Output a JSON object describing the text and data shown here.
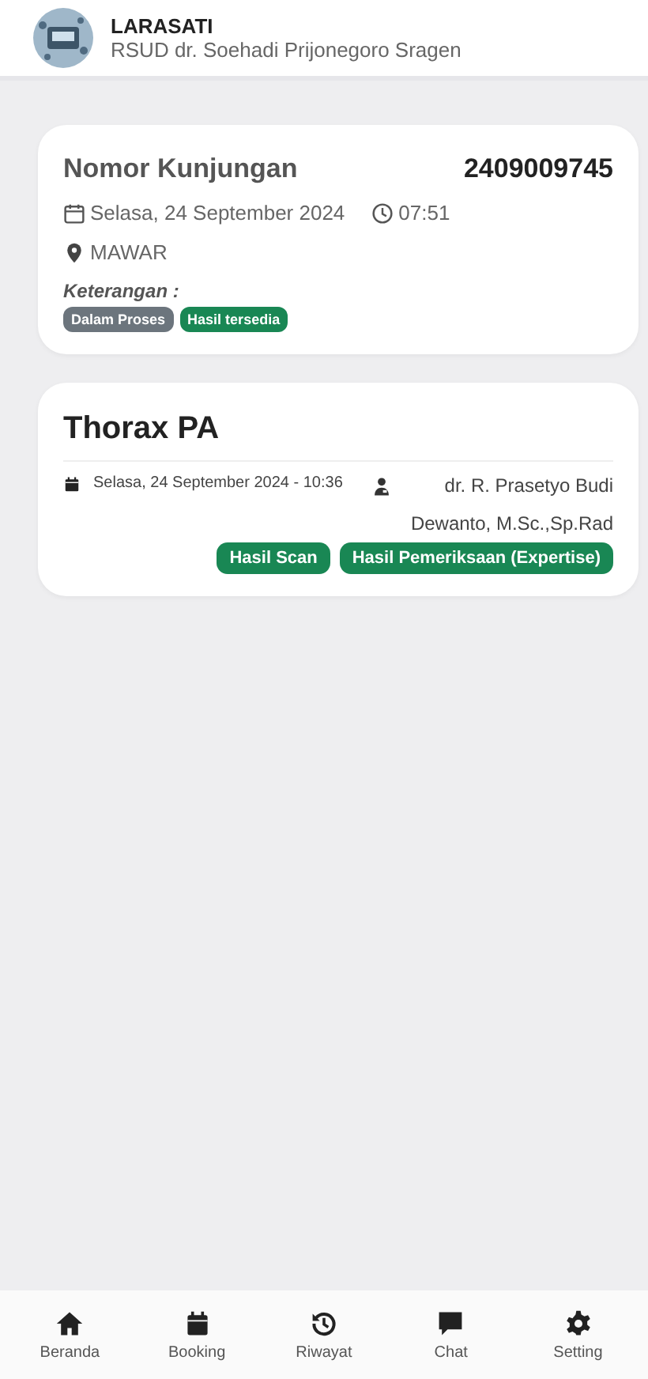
{
  "header": {
    "title": "LARASATI",
    "subtitle": "RSUD dr. Soehadi Prijonegoro Sragen"
  },
  "visit": {
    "label": "Nomor Kunjungan",
    "number": "2409009745",
    "date": "Selasa, 24 September 2024",
    "time": "07:51",
    "location": "MAWAR",
    "note_label": "Keterangan :",
    "badges": [
      {
        "text": "Dalam Proses",
        "color": "#6c757d"
      },
      {
        "text": "Hasil tersedia",
        "color": "#198754"
      }
    ]
  },
  "exam": {
    "title": "Thorax PA",
    "datetime": "Selasa, 24 September 2024 - 10:36",
    "doctor": "dr. R. Prasetyo Budi Dewanto, M.Sc.,Sp.Rad",
    "buttons": [
      "Hasil Scan",
      "Hasil Pemeriksaan (Expertise)"
    ]
  },
  "nav": [
    {
      "kind": "home",
      "label": "Beranda"
    },
    {
      "kind": "calendar",
      "label": "Booking"
    },
    {
      "kind": "history",
      "label": "Riwayat"
    },
    {
      "kind": "chat",
      "label": "Chat"
    },
    {
      "kind": "gear",
      "label": "Setting"
    }
  ]
}
